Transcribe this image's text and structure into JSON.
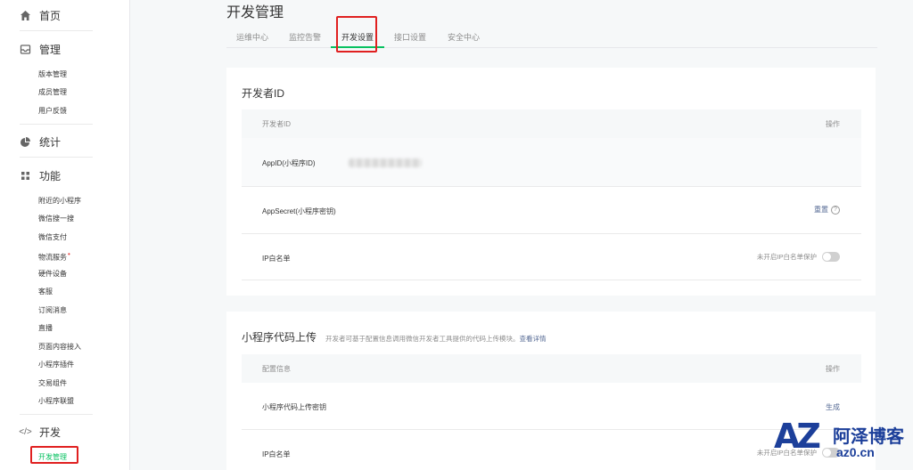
{
  "sidebar": {
    "home": {
      "label": "首页",
      "icon": "home-icon"
    },
    "manage": {
      "label": "管理",
      "icon": "inbox-icon",
      "items": [
        "版本管理",
        "成员管理",
        "用户反馈"
      ]
    },
    "stats": {
      "label": "统计",
      "icon": "pie-chart-icon"
    },
    "features": {
      "label": "功能",
      "icon": "grid-icon",
      "items": [
        "附近的小程序",
        "微信搜一搜",
        "微信支付",
        "物流服务",
        "硬件设备",
        "客服",
        "订阅消息",
        "直播",
        "页面内容接入",
        "小程序插件",
        "交易组件",
        "小程序联盟"
      ]
    },
    "dev": {
      "label": "开发",
      "icon": "code-icon",
      "items": [
        "开发管理"
      ]
    }
  },
  "header": {
    "title": "开发管理",
    "tabs": [
      "运维中心",
      "监控告警",
      "开发设置",
      "接口设置",
      "安全中心"
    ]
  },
  "dev_id_card": {
    "title": "开发者ID",
    "col1": "开发者ID",
    "col2": "操作",
    "rows": {
      "appid": "AppID(小程序ID)",
      "secret": "AppSecret(小程序密钥)",
      "secret_action": "重置",
      "whitelist": "IP白名单",
      "whitelist_status": "未开启IP白名单保护"
    }
  },
  "upload_card": {
    "title": "小程序代码上传",
    "desc": "开发者可基于配置信息调用微信开发者工具提供的代码上传模块。",
    "link": "查看详情",
    "col1": "配置信息",
    "col2": "操作",
    "rows": {
      "key": "小程序代码上传密钥",
      "key_action": "生成",
      "whitelist": "IP白名单",
      "whitelist_status": "未开启IP白名单保护"
    }
  },
  "watermark": {
    "logo": "AZ",
    "name": "阿泽博客",
    "url": "az0.cn"
  },
  "colors": {
    "accent": "#07c160",
    "link": "#576b95",
    "highlight_box": "#e02020"
  }
}
